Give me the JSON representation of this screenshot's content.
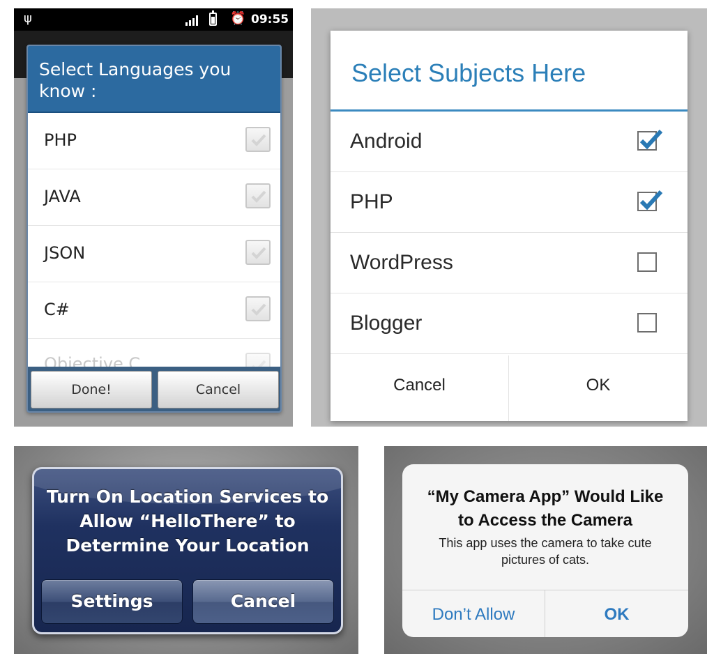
{
  "android_legacy_dialog": {
    "status_bar": {
      "usb_icon": "usb-icon",
      "signal_icon": "signal-bars-icon",
      "battery_icon": "battery-charging-icon",
      "alarm_icon": "alarm-clock-icon",
      "time": "09:55"
    },
    "title": "Select Languages you know :",
    "items": [
      {
        "label": "PHP",
        "checked": false
      },
      {
        "label": "JAVA",
        "checked": false
      },
      {
        "label": "JSON",
        "checked": false
      },
      {
        "label": "C#",
        "checked": false
      },
      {
        "label": "Objective C",
        "checked": false
      }
    ],
    "buttons": {
      "done": "Done!",
      "cancel": "Cancel"
    },
    "colors": {
      "title_bg": "#2c6aa0",
      "button_bar": "#3b5f82"
    }
  },
  "android_holo_dialog": {
    "title": "Select Subjects Here",
    "items": [
      {
        "label": "Android",
        "checked": true
      },
      {
        "label": "PHP",
        "checked": true
      },
      {
        "label": "WordPress",
        "checked": false
      },
      {
        "label": "Blogger",
        "checked": false
      }
    ],
    "buttons": {
      "cancel": "Cancel",
      "ok": "OK"
    },
    "colors": {
      "accent": "#2b7fb8",
      "check": "#2a79b4"
    }
  },
  "ios_legacy_alert": {
    "title": "Turn On Location Services to\nAllow “HelloThere” to\nDetermine Your Location",
    "buttons": {
      "settings": "Settings",
      "cancel": "Cancel"
    },
    "colors": {
      "alert_bg": "#1f3160"
    }
  },
  "ios_modern_alert": {
    "title": "“My Camera App” Would Like\nto Access the Camera",
    "message": "This app uses the camera to take cute\npictures of cats.",
    "buttons": {
      "dont_allow": "Don’t Allow",
      "ok": "OK"
    },
    "colors": {
      "button_text": "#2e7abf"
    }
  }
}
